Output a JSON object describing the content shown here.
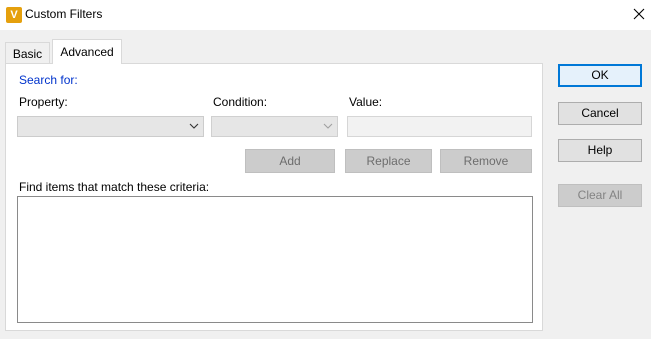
{
  "window": {
    "title": "Custom Filters",
    "icon": "V"
  },
  "tabs": [
    {
      "label": "Basic",
      "active": false
    },
    {
      "label": "Advanced",
      "active": true
    }
  ],
  "advanced": {
    "search_for_label": "Search for:",
    "property_label": "Property:",
    "condition_label": "Condition:",
    "value_label": "Value:",
    "property_value": "",
    "condition_value": "",
    "value_value": "",
    "add_label": "Add",
    "replace_label": "Replace",
    "remove_label": "Remove",
    "criteria_label": "Find items that match these criteria:"
  },
  "side_buttons": {
    "ok": "OK",
    "cancel": "Cancel",
    "help": "Help",
    "clear_all": "Clear All"
  },
  "colors": {
    "accent": "#0078d7",
    "search_for_text": "#0033cc",
    "app_icon": "#e5a00d"
  },
  "icons": [
    "app-icon",
    "close-icon",
    "chevron-down-icon"
  ]
}
